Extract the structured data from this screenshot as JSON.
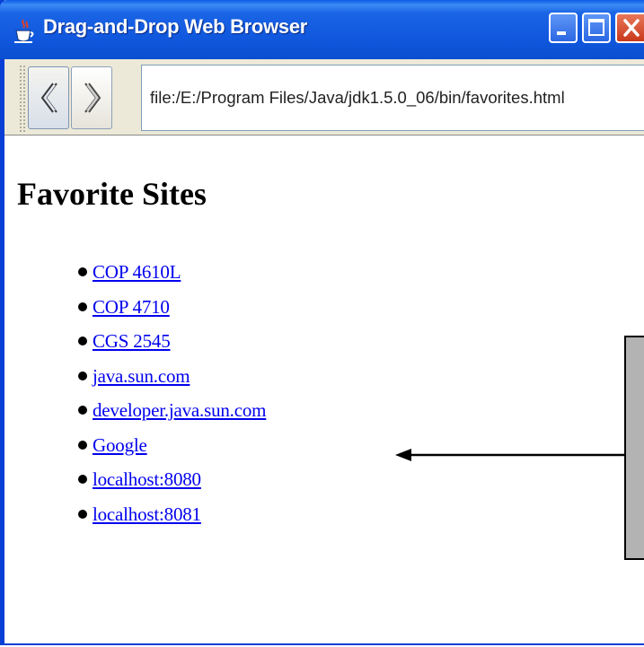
{
  "window": {
    "title": "Drag-and-Drop Web Browser",
    "icon": "java-cup-icon",
    "controls": [
      "minimize-icon",
      "maximize-icon",
      "close-icon"
    ]
  },
  "toolbar": {
    "back_icon": "back-arrow-icon",
    "forward_icon": "forward-arrow-icon",
    "url": "file:/E:/Program Files/Java/jdk1.5.0_06/bin/favorites.html"
  },
  "page": {
    "heading": "Favorite Sites",
    "links": [
      "COP 4610L",
      "COP 4710",
      "CGS 2545",
      "java.sun.com",
      "developer.java.sun.com",
      "Google",
      "localhost:8080",
      "localhost:8081"
    ]
  },
  "colors": {
    "titlebar": "#0f56dc",
    "link": "#0000ee",
    "annotation_box": "#b3b3b3"
  }
}
